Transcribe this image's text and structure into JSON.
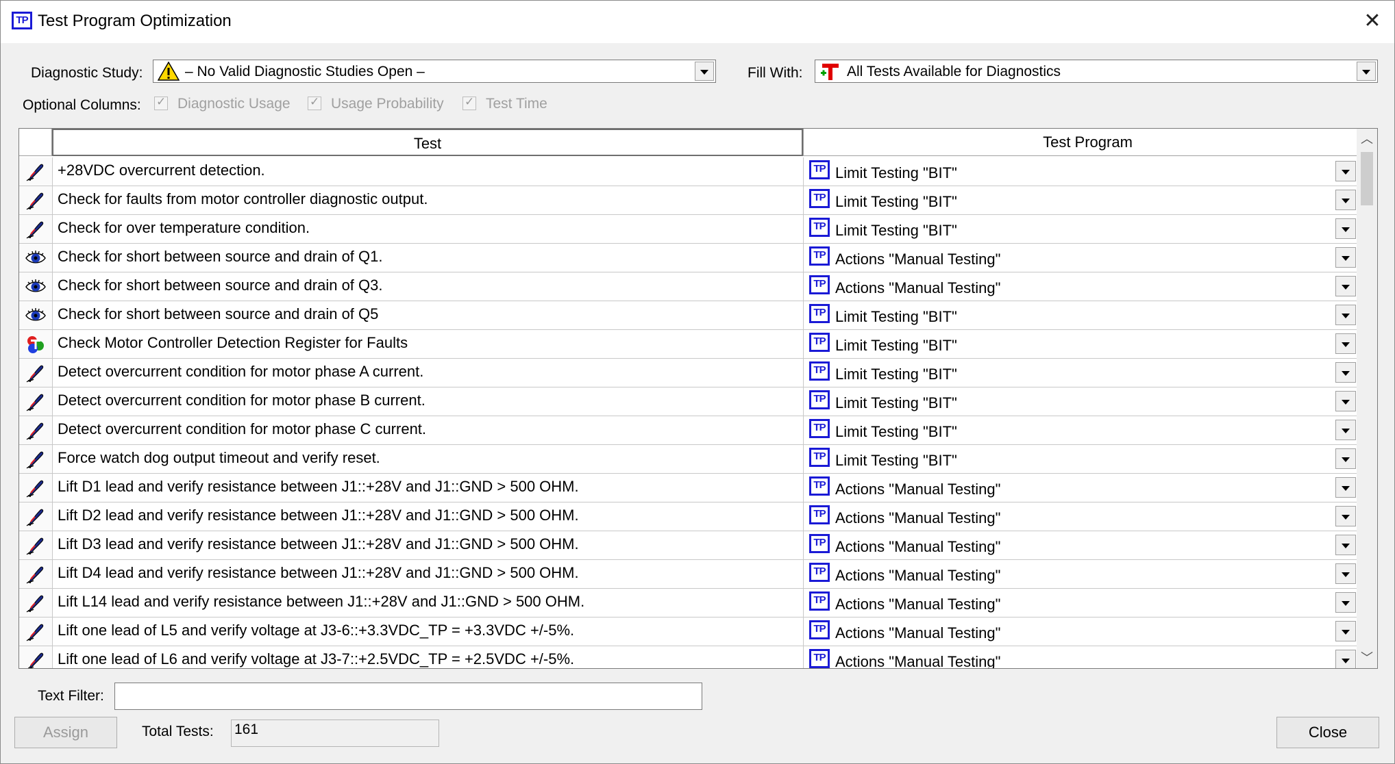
{
  "window": {
    "title": "Test Program Optimization",
    "app_icon": "TP",
    "close_glyph": "✕"
  },
  "diagnostic_study": {
    "label": "Diagnostic Study:",
    "value": "– No Valid Diagnostic Studies Open –",
    "icon": "warning-icon"
  },
  "fill_with": {
    "label": "Fill With:",
    "value": "All Tests Available for Diagnostics",
    "icon": "tests-icon"
  },
  "optional_columns": {
    "label": "Optional Columns:",
    "items": [
      {
        "label": "Diagnostic Usage",
        "checked": true,
        "disabled": true
      },
      {
        "label": "Usage Probability",
        "checked": true,
        "disabled": true
      },
      {
        "label": "Test Time",
        "checked": true,
        "disabled": true
      }
    ]
  },
  "grid": {
    "columns": {
      "test": "Test",
      "program": "Test Program"
    },
    "program_icon": "TP",
    "rows": [
      {
        "icon": "pen-icon",
        "test": "+28VDC overcurrent detection.",
        "program": "Limit Testing \"BIT\""
      },
      {
        "icon": "pen-icon",
        "test": "Check for faults from motor controller diagnostic output.",
        "program": "Limit Testing \"BIT\""
      },
      {
        "icon": "pen-icon",
        "test": "Check for over temperature condition.",
        "program": "Limit Testing \"BIT\""
      },
      {
        "icon": "eye-icon",
        "test": "Check for short between source and drain of Q1.",
        "program": "Actions \"Manual Testing\""
      },
      {
        "icon": "eye-icon",
        "test": "Check for short between source and drain of Q3.",
        "program": "Actions \"Manual Testing\""
      },
      {
        "icon": "eye-icon",
        "test": "Check for short between source and drain of Q5",
        "program": "Limit Testing \"BIT\""
      },
      {
        "icon": "multicolor-test-icon",
        "test": "Check Motor Controller Detection Register for Faults",
        "program": "Limit Testing \"BIT\""
      },
      {
        "icon": "pen-icon",
        "test": "Detect overcurrent condition for motor phase A current.",
        "program": "Limit Testing \"BIT\""
      },
      {
        "icon": "pen-icon",
        "test": "Detect overcurrent condition for motor phase B current.",
        "program": "Limit Testing \"BIT\""
      },
      {
        "icon": "pen-icon",
        "test": "Detect overcurrent condition for motor phase C current.",
        "program": "Limit Testing \"BIT\""
      },
      {
        "icon": "pen-icon",
        "test": "Force watch dog output timeout and verify reset.",
        "program": "Limit Testing \"BIT\""
      },
      {
        "icon": "pen-icon",
        "test": "Lift D1 lead and verify resistance between J1::+28V and J1::GND > 500 OHM.",
        "program": "Actions \"Manual Testing\""
      },
      {
        "icon": "pen-icon",
        "test": "Lift D2 lead and verify resistance between J1::+28V and J1::GND > 500 OHM.",
        "program": "Actions \"Manual Testing\""
      },
      {
        "icon": "pen-icon",
        "test": "Lift D3 lead and verify resistance between J1::+28V and J1::GND > 500 OHM.",
        "program": "Actions \"Manual Testing\""
      },
      {
        "icon": "pen-icon",
        "test": "Lift D4 lead and verify resistance between J1::+28V and J1::GND > 500 OHM.",
        "program": "Actions \"Manual Testing\""
      },
      {
        "icon": "pen-icon",
        "test": "Lift L14 lead and verify resistance between J1::+28V and J1::GND > 500 OHM.",
        "program": "Actions \"Manual Testing\""
      },
      {
        "icon": "pen-icon",
        "test": "Lift one lead of L5 and verify voltage at J3-6::+3.3VDC_TP = +3.3VDC +/-5%.",
        "program": "Actions \"Manual Testing\""
      },
      {
        "icon": "pen-icon",
        "test": "Lift one lead of L6 and verify voltage at J3-7::+2.5VDC_TP = +2.5VDC +/-5%.",
        "program": "Actions \"Manual Testing\""
      }
    ]
  },
  "text_filter": {
    "label": "Text Filter:",
    "value": ""
  },
  "assign_button": {
    "label": "Assign",
    "disabled": true
  },
  "total_tests": {
    "label": "Total Tests:",
    "value": "161"
  },
  "close_button": {
    "label": "Close"
  }
}
